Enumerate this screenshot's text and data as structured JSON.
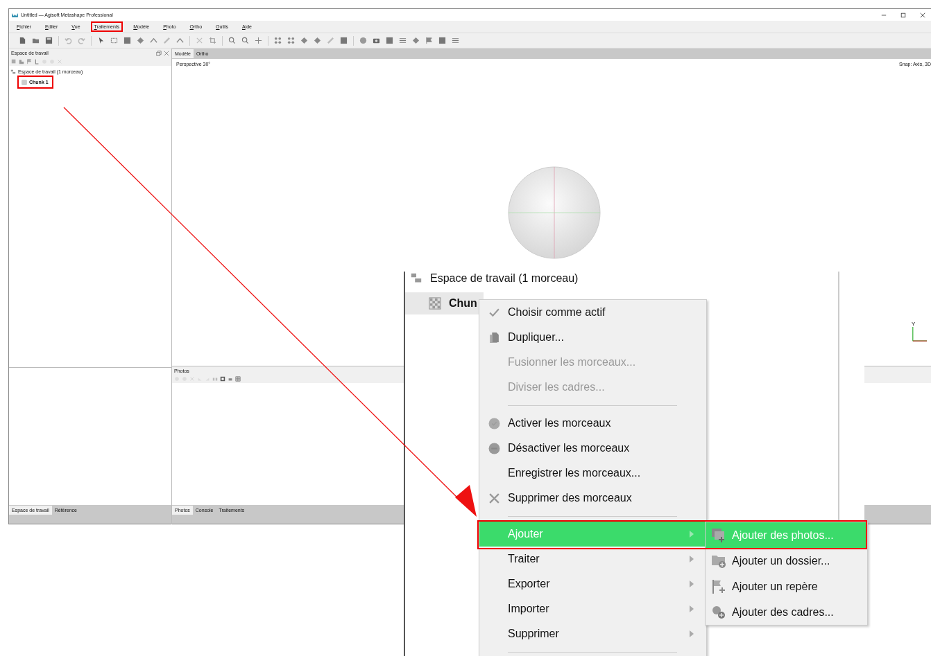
{
  "window": {
    "title": "Untitled — Agisoft Metashape Professional"
  },
  "menu": [
    {
      "label": "Fichier",
      "annotated": false
    },
    {
      "label": "Editer",
      "annotated": false
    },
    {
      "label": "Vue",
      "annotated": false
    },
    {
      "label": "Traitements",
      "annotated": true
    },
    {
      "label": "Modèle",
      "annotated": false
    },
    {
      "label": "Photo",
      "annotated": false
    },
    {
      "label": "Ortho",
      "annotated": false
    },
    {
      "label": "Outils",
      "annotated": false
    },
    {
      "label": "Aide",
      "annotated": false
    }
  ],
  "workspace_panel": {
    "title": "Espace de travail",
    "tree": {
      "label": "Espace de travail (1 morceau)",
      "children": [
        {
          "label": "Chunk 1",
          "annotated": true
        }
      ]
    }
  },
  "left_tabs": [
    {
      "label": "Espace de travail",
      "selected": true
    },
    {
      "label": "Référence",
      "selected": false
    }
  ],
  "viewport": {
    "tabs": [
      {
        "label": "Modèle",
        "selected": true
      },
      {
        "label": "Ortho",
        "selected": false
      }
    ],
    "projection": "Perspective 30°",
    "snap": "Snap: Axis, 3D",
    "axis_label": "Y"
  },
  "photos_panel": {
    "title": "Photos"
  },
  "bottom_tabs": [
    {
      "label": "Photos",
      "selected": true
    },
    {
      "label": "Console",
      "selected": false
    },
    {
      "label": "Traitements",
      "selected": false
    }
  ],
  "zoom_inset": {
    "tree_root": "Espace de travail (1 morceau)",
    "tree_item": "Chun",
    "context_menu": [
      {
        "kind": "item",
        "label": "Choisir comme actif",
        "disabled": false,
        "highlighted": false,
        "annotated": false
      },
      {
        "kind": "item",
        "label": "Dupliquer...",
        "disabled": false,
        "highlighted": false,
        "annotated": false
      },
      {
        "kind": "item",
        "label": "Fusionner les morceaux...",
        "disabled": true,
        "highlighted": false,
        "annotated": false
      },
      {
        "kind": "item",
        "label": "Diviser les cadres...",
        "disabled": true,
        "highlighted": false,
        "annotated": false
      },
      {
        "kind": "separator"
      },
      {
        "kind": "item",
        "label": "Activer les morceaux",
        "disabled": false,
        "highlighted": false,
        "annotated": false
      },
      {
        "kind": "item",
        "label": "Désactiver les morceaux",
        "disabled": false,
        "highlighted": false,
        "annotated": false
      },
      {
        "kind": "item",
        "label": "Enregistrer les morceaux...",
        "disabled": false,
        "highlighted": false,
        "annotated": false
      },
      {
        "kind": "item",
        "label": "Supprimer des morceaux",
        "disabled": false,
        "highlighted": false,
        "annotated": false
      },
      {
        "kind": "separator"
      },
      {
        "kind": "submenu",
        "label": "Ajouter",
        "disabled": false,
        "highlighted": true,
        "annotated": true
      },
      {
        "kind": "submenu",
        "label": "Traiter",
        "disabled": false,
        "highlighted": false,
        "annotated": false
      },
      {
        "kind": "submenu",
        "label": "Exporter",
        "disabled": false,
        "highlighted": false,
        "annotated": false
      },
      {
        "kind": "submenu",
        "label": "Importer",
        "disabled": false,
        "highlighted": false,
        "annotated": false
      },
      {
        "kind": "submenu",
        "label": "Supprimer",
        "disabled": false,
        "highlighted": false,
        "annotated": false
      },
      {
        "kind": "separator"
      }
    ],
    "submenu": [
      {
        "label": "Ajouter des photos...",
        "highlighted": true
      },
      {
        "label": "Ajouter un dossier...",
        "highlighted": false
      },
      {
        "label": "Ajouter un repère",
        "highlighted": false
      },
      {
        "label": "Ajouter des cadres...",
        "highlighted": false
      }
    ]
  }
}
